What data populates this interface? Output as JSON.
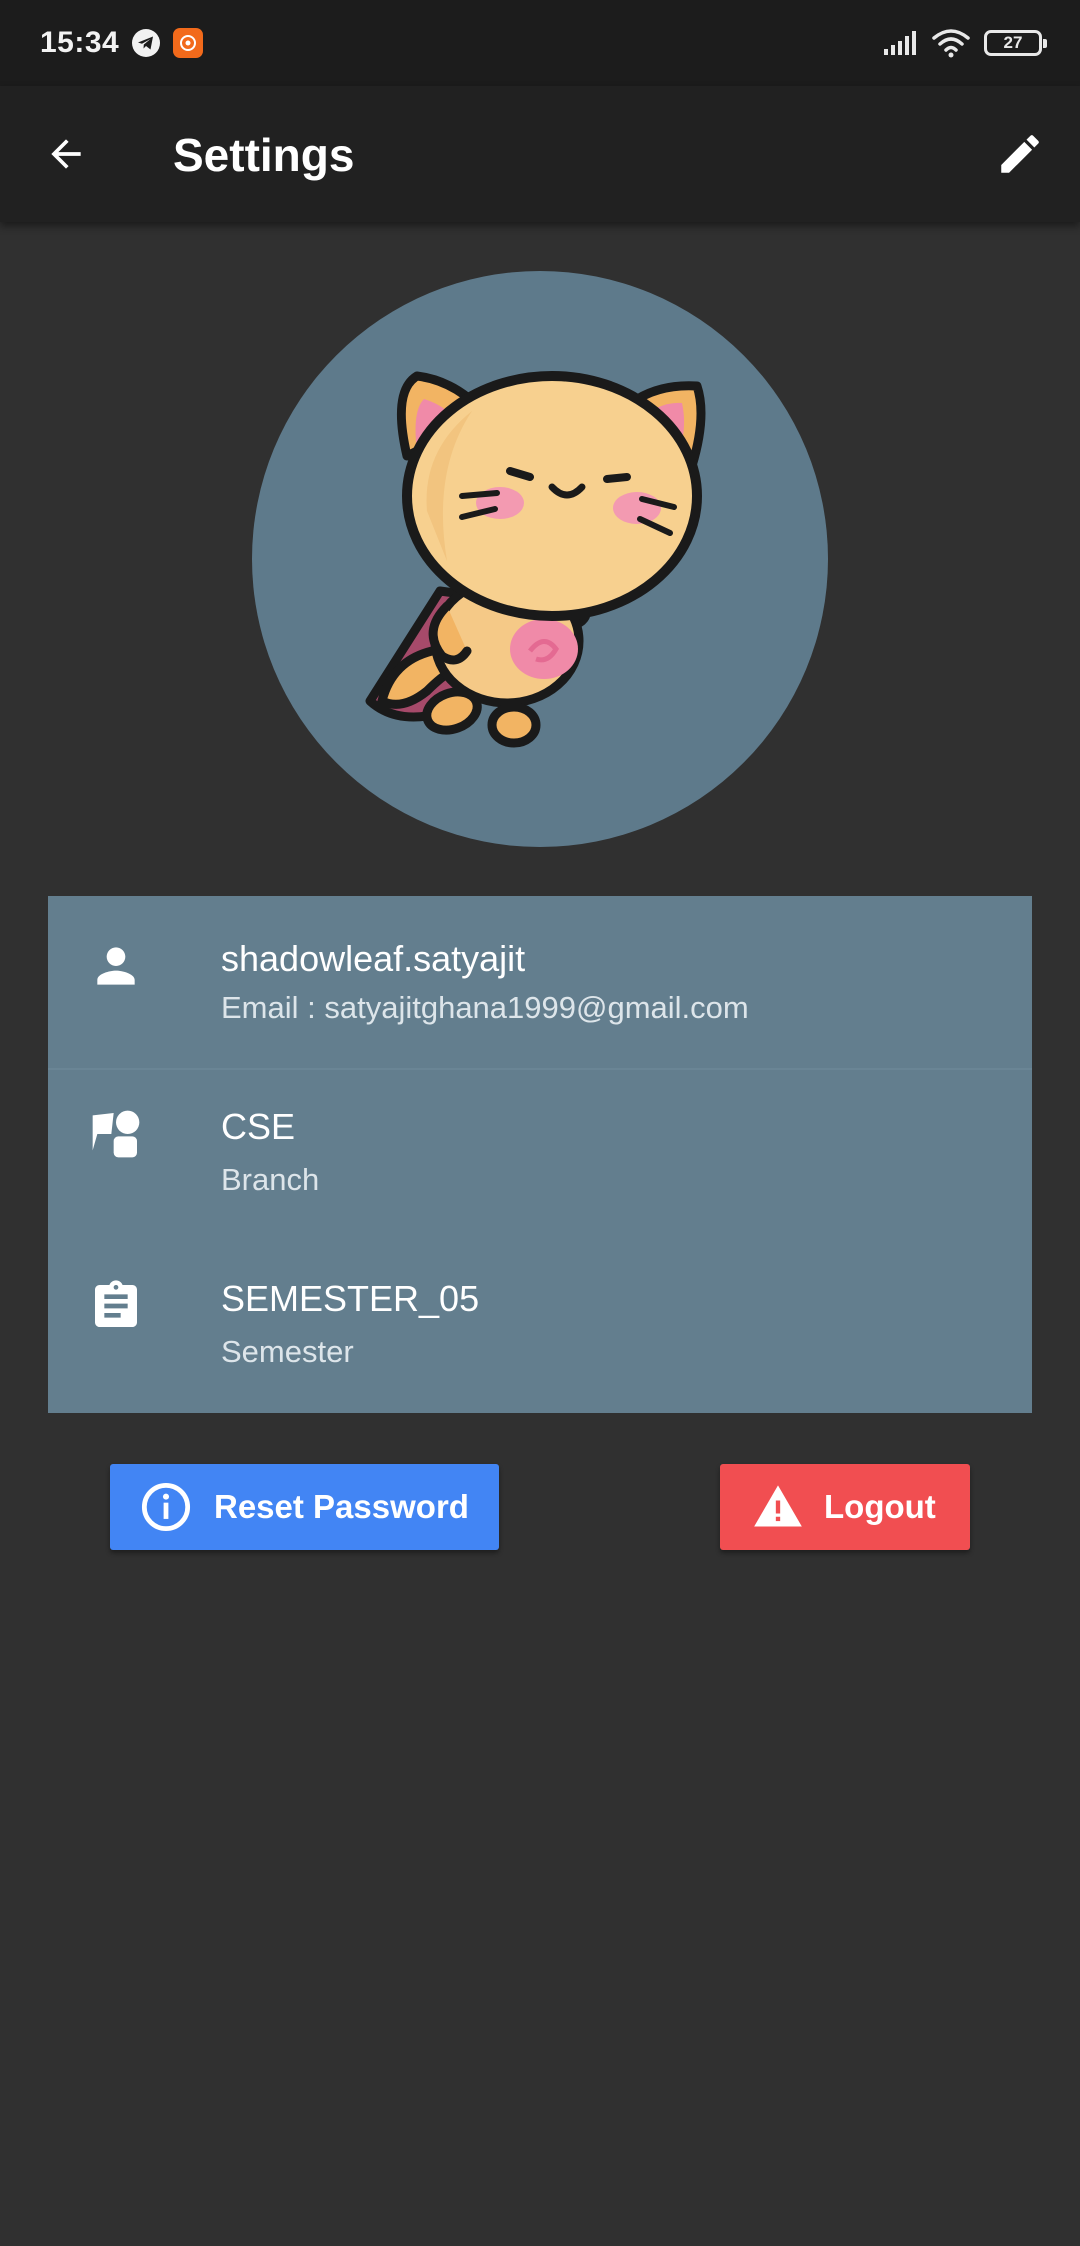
{
  "status_bar": {
    "time": "15:34",
    "battery": "27"
  },
  "app_bar": {
    "title": "Settings"
  },
  "profile": {
    "username": "shadowleaf.satyajit",
    "email_line": "Email : satyajitghana1999@gmail.com",
    "branch_value": "CSE",
    "branch_label": "Branch",
    "semester_value": "SEMESTER_05",
    "semester_label": "Semester"
  },
  "actions": {
    "reset_label": "Reset Password",
    "logout_label": "Logout"
  },
  "colors": {
    "background": "#303030",
    "app_bar": "#212121",
    "card": "#637e8e",
    "avatar_bg": "#5e7a8b",
    "reset_button": "#4285f4",
    "logout_button": "#f14e51"
  },
  "icons": {
    "back": "arrow-back-icon",
    "edit": "pencil-icon",
    "user": "person-icon",
    "branch": "category-icon",
    "semester": "clipboard-icon",
    "info": "info-icon",
    "warning": "warning-icon"
  }
}
